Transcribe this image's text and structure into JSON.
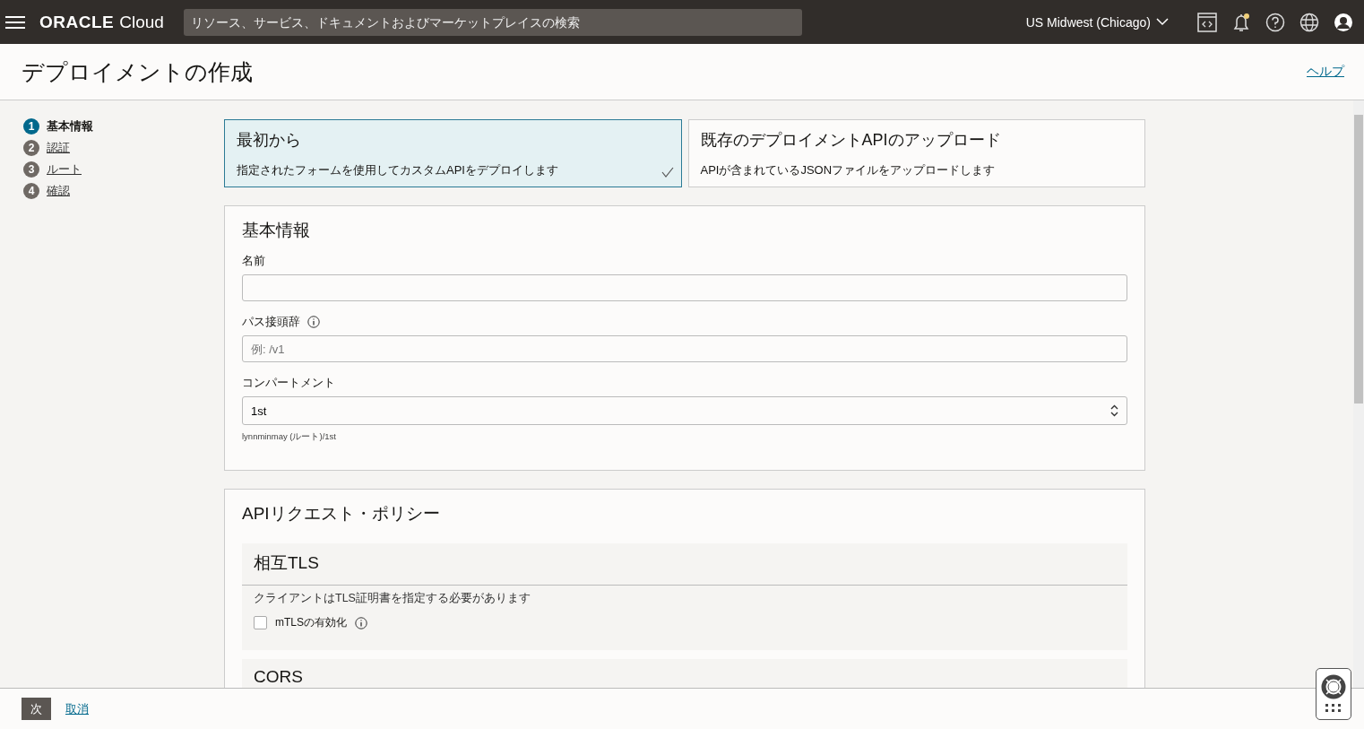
{
  "header": {
    "brand": "ORACLE",
    "brand_suffix": "Cloud",
    "search": {
      "placeholder": "リソース、サービス、ドキュメントおよびマーケットプレイスの検索"
    },
    "region": "US Midwest (Chicago)",
    "notification": true
  },
  "page": {
    "title": "デプロイメントの作成",
    "help": "ヘルプ"
  },
  "steps": [
    {
      "number": "1",
      "label": "基本情報",
      "selected": true
    },
    {
      "number": "2",
      "label": "認証",
      "selected": false
    },
    {
      "number": "3",
      "label": "ルート",
      "selected": false
    },
    {
      "number": "4",
      "label": "確認",
      "selected": false
    }
  ],
  "options": [
    {
      "title": "最初から",
      "description": "指定されたフォームを使用してカスタムAPIをデプロイします",
      "selected": true
    },
    {
      "title": "既存のデプロイメントAPIのアップロード",
      "description": "APIが含まれているJSONファイルをアップロードします",
      "selected": false
    }
  ],
  "basic_info": {
    "title": "基本情報",
    "name": {
      "label": "名前"
    },
    "path_prefix": {
      "label": "パス接頭辞",
      "placeholder": "例: /v1"
    },
    "compartment": {
      "label": "コンパートメント",
      "value": "1st",
      "hint": "lynnminmay (ルート)/1st"
    }
  },
  "policies": {
    "title": "APIリクエスト・ポリシー",
    "sections": [
      {
        "title": "相互TLS",
        "description": "クライアントはTLS証明書を指定する必要があります",
        "checkbox": {
          "label": "mTLSの有効化",
          "checked": false
        }
      },
      {
        "title": "CORS"
      }
    ]
  },
  "footer": {
    "next": "次",
    "cancel": "取消"
  }
}
